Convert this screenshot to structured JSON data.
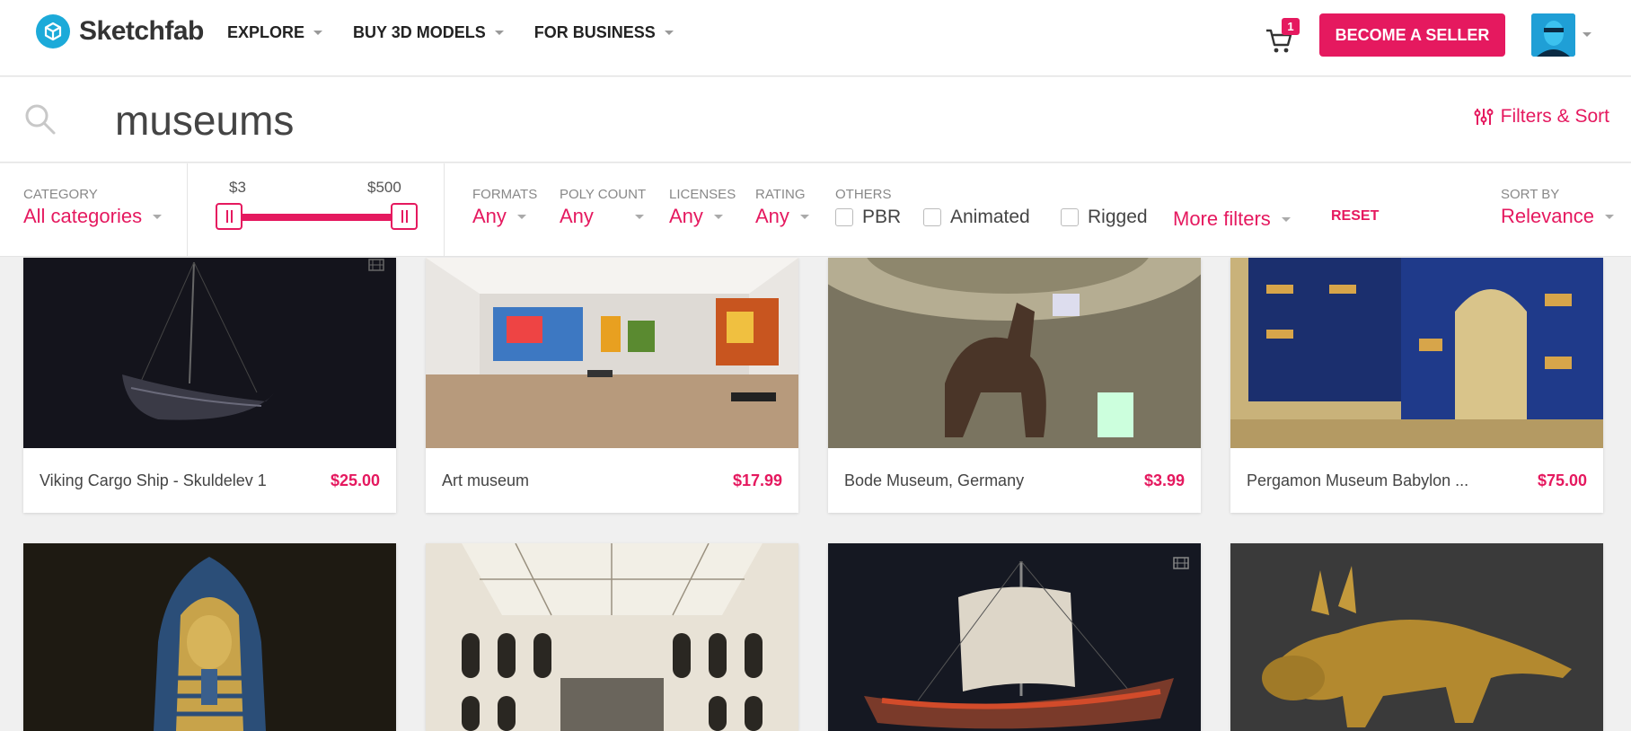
{
  "header": {
    "logo_text": "Sketchfab",
    "nav": [
      {
        "label": "EXPLORE"
      },
      {
        "label": "BUY 3D MODELS"
      },
      {
        "label": "FOR BUSINESS"
      }
    ],
    "cart_count": "1",
    "seller_button": "BECOME A SELLER"
  },
  "search": {
    "query": "museums",
    "filters_sort_label": "Filters & Sort"
  },
  "filters": {
    "category": {
      "label": "CATEGORY",
      "value": "All categories"
    },
    "price": {
      "min_label": "$3",
      "max_label": "$500"
    },
    "formats": {
      "label": "FORMATS",
      "value": "Any"
    },
    "poly_count": {
      "label": "POLY COUNT",
      "value": "Any"
    },
    "licenses": {
      "label": "LICENSES",
      "value": "Any"
    },
    "rating": {
      "label": "RATING",
      "value": "Any"
    },
    "others": {
      "label": "OTHERS",
      "pbr": "PBR",
      "animated": "Animated",
      "rigged": "Rigged"
    },
    "more_filters": "More filters",
    "reset": "RESET",
    "sort": {
      "label": "SORT BY",
      "value": "Relevance"
    }
  },
  "results": [
    {
      "title": "Viking Cargo Ship - Skuldelev 1",
      "price": "$25.00",
      "animated": true
    },
    {
      "title": "Art museum",
      "price": "$17.99",
      "animated": false
    },
    {
      "title": "Bode Museum, Germany",
      "price": "$3.99",
      "animated": false
    },
    {
      "title": "Pergamon Museum Babylon ...",
      "price": "$75.00",
      "animated": false
    }
  ],
  "colors": {
    "accent": "#e5195f",
    "brand": "#1caad9"
  }
}
